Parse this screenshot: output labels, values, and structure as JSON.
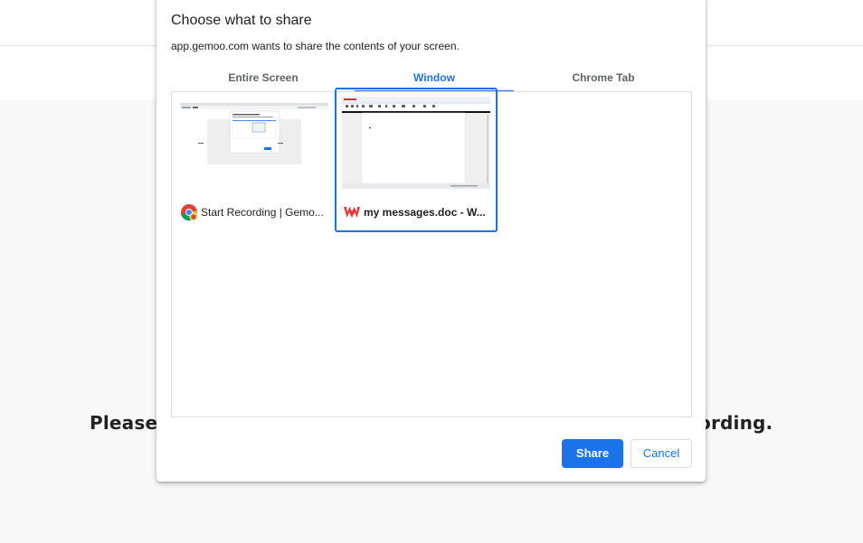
{
  "background": {
    "text_left": "Please",
    "text_right": "ording."
  },
  "dialog": {
    "title": "Choose what to share",
    "subtitle": "app.gemoo.com wants to share the contents of your screen.",
    "tabs": [
      {
        "label": "Entire Screen",
        "active": false
      },
      {
        "label": "Window",
        "active": true
      },
      {
        "label": "Chrome Tab",
        "active": false
      }
    ],
    "sources": [
      {
        "label": "Start Recording | Gemo...",
        "icon": "chrome-icon",
        "selected": false
      },
      {
        "label": "my messages.doc - W...",
        "icon": "wps-office-icon",
        "selected": true
      }
    ],
    "buttons": {
      "share": "Share",
      "cancel": "Cancel"
    }
  },
  "colors": {
    "accent": "#1a73e8",
    "page_bg": "#f8f8f8"
  }
}
